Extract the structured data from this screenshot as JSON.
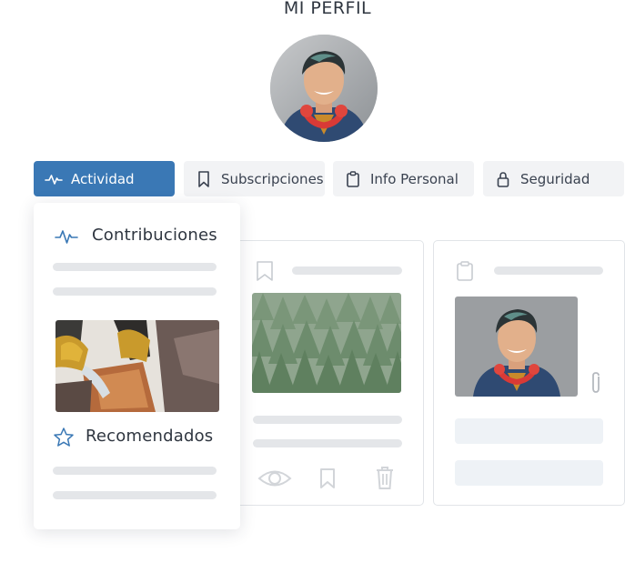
{
  "page": {
    "title": "MI PERFIL"
  },
  "tabs": [
    {
      "label": "Actividad",
      "icon": "activity-icon",
      "active": true
    },
    {
      "label": "Subscripciones",
      "icon": "bookmark-icon",
      "active": false
    },
    {
      "label": "Info Personal",
      "icon": "clipboard-icon",
      "active": false
    },
    {
      "label": "Seguridad",
      "icon": "lock-icon",
      "active": false
    }
  ],
  "popup": {
    "contributions_title": "Contribuciones",
    "recommended_title": "Recomendados"
  },
  "colors": {
    "accent": "#3a78b5",
    "skeleton": "#e4e6e9",
    "tab_bg": "#f2f3f5"
  }
}
